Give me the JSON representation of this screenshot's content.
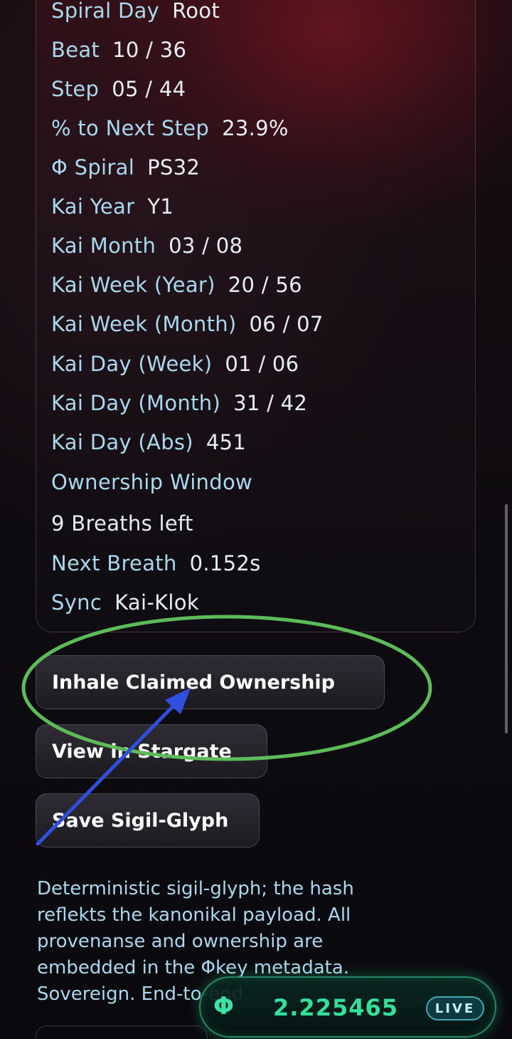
{
  "details": [
    {
      "label": "Spiral Day",
      "value": "Root"
    },
    {
      "label": "Beat",
      "value": "10 / 36"
    },
    {
      "label": "Step",
      "value": "05 / 44"
    },
    {
      "label": "% to Next Step",
      "value": "23.9%"
    },
    {
      "label": "Φ Spiral",
      "value": "PS32"
    },
    {
      "label": "Kai Year",
      "value": "Y1"
    },
    {
      "label": "Kai Month",
      "value": "03 / 08"
    },
    {
      "label": "Kai Week (Year)",
      "value": "20 / 56"
    },
    {
      "label": "Kai Week (Month)",
      "value": "06 / 07"
    },
    {
      "label": "Kai Day (Week)",
      "value": "01 / 06"
    },
    {
      "label": "Kai Day (Month)",
      "value": "31 / 42"
    },
    {
      "label": "Kai Day (Abs)",
      "value": "451"
    }
  ],
  "ownership": {
    "title": "Ownership Window",
    "breaths_left": "9 Breaths left",
    "next_breath_label": "Next Breath",
    "next_breath_value": "0.152s",
    "sync_label": "Sync",
    "sync_value": "Kai-Klok"
  },
  "actions": {
    "inhale_label": "Inhale Claimed Ownership",
    "stargate_label": "View in Stargate",
    "save_label": "Save Sigil-Glyph"
  },
  "description": "Deterministic sigil-glyph; the hash reflekts the kanonikal payload. All provenanse and ownership are embedded in the Φkey metadata. Sovereign. End-to-end.",
  "live": {
    "symbol": "Φ",
    "amount": "2.225465",
    "badge": "LIVE"
  },
  "colors": {
    "label_cyan": "#a9d8ee",
    "value_white": "#e6eef3",
    "live_green": "#33e09c",
    "annotation_green": "#5dbb5a",
    "annotation_blue": "#2f4fe0"
  },
  "annotations": [
    "green ellipse around Inhale Claimed Ownership",
    "blue arrow pointing to Inhale Claimed Ownership"
  ]
}
